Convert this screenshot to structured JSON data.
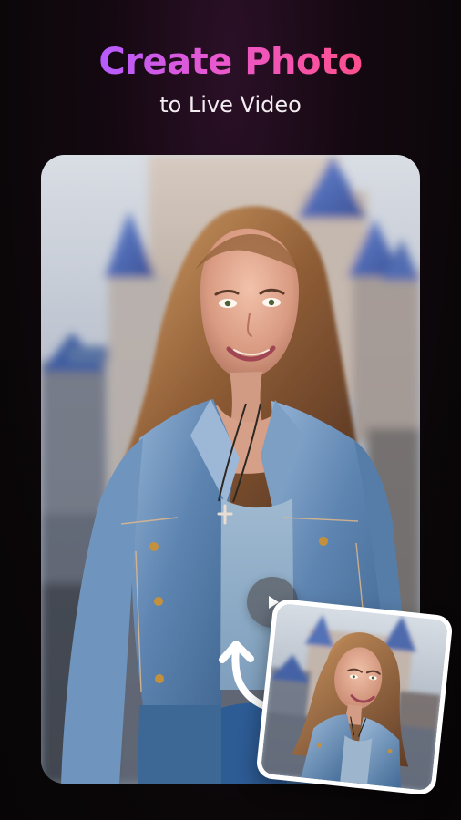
{
  "promo": {
    "title": "Create Photo",
    "subtitle": "to Live Video"
  },
  "media": {
    "play_icon": "play-icon",
    "arrow_icon": "curved-arrow-icon"
  },
  "colors": {
    "background_dark": "#0b0709",
    "title_gradient_start": "#b55cff",
    "title_gradient_end": "#ff4f8c",
    "subtitle": "#f3edf1",
    "card_frame": "#ffffff",
    "play_overlay": "#3a2d28"
  }
}
